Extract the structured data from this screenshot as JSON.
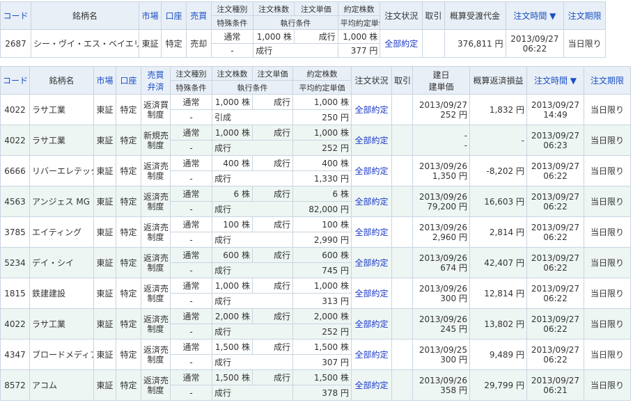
{
  "top": {
    "headers": {
      "code": "コード",
      "name": "銘柄名",
      "market": "市場",
      "account": "口座",
      "side": "売買",
      "order_type": "注文種別",
      "special": "特殊条件",
      "qty": "注文株数",
      "exec_cond": "執行条件",
      "price": "注文単価",
      "filled": "約定株数",
      "avg_price": "平均約定単価",
      "status": "注文状況",
      "cancel": "取引",
      "amount": "概算受渡代金",
      "time": "注文時間 ▼",
      "expiry": "注文期限"
    },
    "row": {
      "code": "2687",
      "name": "シー・ヴイ・エス・ベイエリア",
      "market": "東証",
      "account": "特定",
      "side": "売却",
      "type": "通常",
      "special": "-",
      "qty": "1,000 株",
      "exec": "成行",
      "price": "成行",
      "filled": "1,000 株",
      "avg": "377 円",
      "status": "全部約定",
      "amount": "376,811 円",
      "date": "2013/09/27",
      "time": "06:22",
      "expiry": "当日限り"
    }
  },
  "main": {
    "headers": {
      "code": "コード",
      "name": "銘柄名",
      "market": "市場",
      "account": "口座",
      "side1": "売買",
      "side2": "弁済",
      "order_type": "注文種別",
      "special": "特殊条件",
      "qty": "注文株数",
      "exec_cond": "執行条件",
      "price": "注文単価",
      "filled": "約定株数",
      "avg_price": "平均約定単価",
      "status": "注文状況",
      "cancel": "取引",
      "open1": "建日",
      "open2": "建単価",
      "pl": "概算返済損益",
      "time": "注文時間 ▼",
      "expiry": "注文期限"
    },
    "rows": [
      {
        "code": "4022",
        "name": "ラサ工業",
        "market": "東証",
        "account": "特定",
        "side1": "返済買",
        "side2": "制度",
        "type": "通常",
        "special": "-",
        "qty": "1,000 株",
        "price": "成行",
        "exec": "引成",
        "filled": "1,000 株",
        "avg": "250 円",
        "status": "全部約定",
        "open_date": "2013/09/27",
        "open_price": "252 円",
        "pl": "1,832 円",
        "date": "2013/09/27",
        "time": "14:49",
        "expiry": "当日限り"
      },
      {
        "code": "4022",
        "name": "ラサ工業",
        "market": "東証",
        "account": "特定",
        "side1": "新規売",
        "side2": "制度",
        "type": "通常",
        "special": "-",
        "qty": "1,000 株",
        "price": "成行",
        "exec": "成行",
        "filled": "1,000 株",
        "avg": "252 円",
        "status": "全部約定",
        "open_date": "-",
        "open_price": "-",
        "pl": "-",
        "date": "2013/09/27",
        "time": "06:23",
        "expiry": "当日限り"
      },
      {
        "code": "6666",
        "name": "リバーエレテック",
        "market": "東証",
        "account": "特定",
        "side1": "返済売",
        "side2": "制度",
        "type": "通常",
        "special": "-",
        "qty": "400 株",
        "price": "成行",
        "exec": "成行",
        "filled": "400 株",
        "avg": "1,330 円",
        "status": "全部約定",
        "open_date": "2013/09/26",
        "open_price": "1,350 円",
        "pl": "-8,202 円",
        "date": "2013/09/27",
        "time": "06:22",
        "expiry": "当日限り"
      },
      {
        "code": "4563",
        "name": "アンジェス MG",
        "market": "東証",
        "account": "特定",
        "side1": "返済売",
        "side2": "制度",
        "type": "通常",
        "special": "-",
        "qty": "6 株",
        "price": "成行",
        "exec": "成行",
        "filled": "6 株",
        "avg": "82,000 円",
        "status": "全部約定",
        "open_date": "2013/09/26",
        "open_price": "79,200 円",
        "pl": "16,603 円",
        "date": "2013/09/27",
        "time": "06:22",
        "expiry": "当日限り"
      },
      {
        "code": "3785",
        "name": "エイティング",
        "market": "東証",
        "account": "特定",
        "side1": "返済売",
        "side2": "制度",
        "type": "通常",
        "special": "-",
        "qty": "100 株",
        "price": "成行",
        "exec": "成行",
        "filled": "100 株",
        "avg": "2,990 円",
        "status": "全部約定",
        "open_date": "2013/09/26",
        "open_price": "2,960 円",
        "pl": "2,814 円",
        "date": "2013/09/27",
        "time": "06:22",
        "expiry": "当日限り"
      },
      {
        "code": "5234",
        "name": "デイ・シイ",
        "market": "東証",
        "account": "特定",
        "side1": "返済売",
        "side2": "制度",
        "type": "通常",
        "special": "-",
        "qty": "600 株",
        "price": "成行",
        "exec": "成行",
        "filled": "600 株",
        "avg": "745 円",
        "status": "全部約定",
        "open_date": "2013/09/26",
        "open_price": "674 円",
        "pl": "42,407 円",
        "date": "2013/09/27",
        "time": "06:22",
        "expiry": "当日限り"
      },
      {
        "code": "1815",
        "name": "鉄建建設",
        "market": "東証",
        "account": "特定",
        "side1": "返済売",
        "side2": "制度",
        "type": "通常",
        "special": "-",
        "qty": "1,000 株",
        "price": "成行",
        "exec": "成行",
        "filled": "1,000 株",
        "avg": "313 円",
        "status": "全部約定",
        "open_date": "2013/09/26",
        "open_price": "300 円",
        "pl": "12,814 円",
        "date": "2013/09/27",
        "time": "06:22",
        "expiry": "当日限り"
      },
      {
        "code": "4022",
        "name": "ラサ工業",
        "market": "東証",
        "account": "特定",
        "side1": "返済売",
        "side2": "制度",
        "type": "通常",
        "special": "-",
        "qty": "2,000 株",
        "price": "成行",
        "exec": "成行",
        "filled": "2,000 株",
        "avg": "252 円",
        "status": "全部約定",
        "open_date": "2013/09/26",
        "open_price": "245 円",
        "pl": "13,802 円",
        "date": "2013/09/27",
        "time": "06:22",
        "expiry": "当日限り"
      },
      {
        "code": "4347",
        "name": "ブロードメディア",
        "market": "東証",
        "account": "特定",
        "side1": "返済売",
        "side2": "制度",
        "type": "通常",
        "special": "-",
        "qty": "1,500 株",
        "price": "成行",
        "exec": "成行",
        "filled": "1,500 株",
        "avg": "307 円",
        "status": "全部約定",
        "open_date": "2013/09/25",
        "open_price": "300 円",
        "pl": "9,489 円",
        "date": "2013/09/27",
        "time": "06:22",
        "expiry": "当日限り"
      },
      {
        "code": "8572",
        "name": "アコム",
        "market": "東証",
        "account": "特定",
        "side1": "返済売",
        "side2": "制度",
        "type": "通常",
        "special": "-",
        "qty": "1,500 株",
        "price": "成行",
        "exec": "成行",
        "filled": "1,500 株",
        "avg": "378 円",
        "status": "全部約定",
        "open_date": "2013/09/26",
        "open_price": "358 円",
        "pl": "29,799 円",
        "date": "2013/09/27",
        "time": "06:21",
        "expiry": "当日限り"
      }
    ]
  },
  "colors": {
    "header_bg": "#e8eff7",
    "link": "#1a39c9",
    "zebra": "#eef6f3",
    "border": "#c9d4e0"
  }
}
